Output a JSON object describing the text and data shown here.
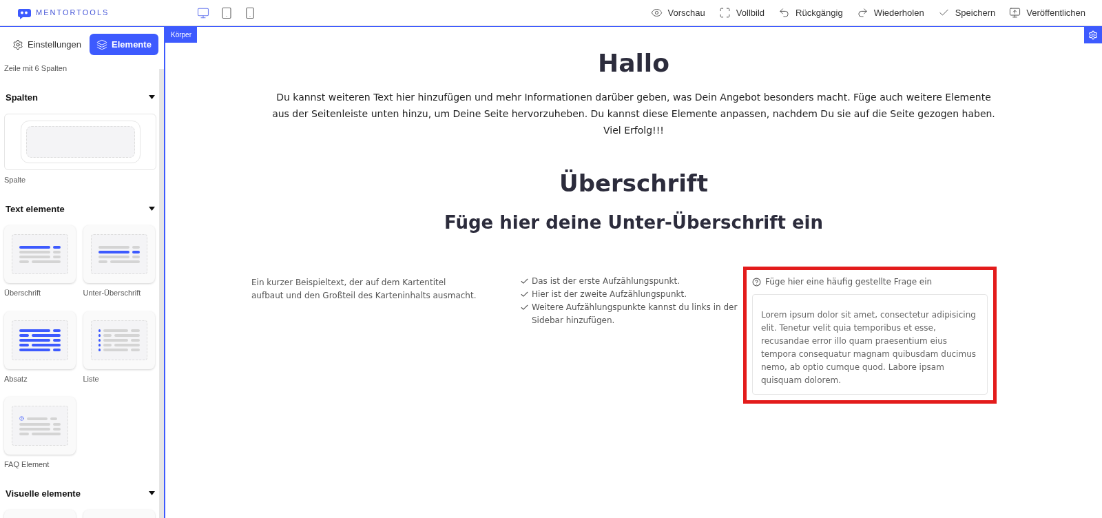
{
  "header": {
    "logo": "MENTORTOOLS",
    "devices": [
      {
        "kind": "desktop",
        "selected": true
      },
      {
        "kind": "tablet",
        "selected": false
      },
      {
        "kind": "phone",
        "selected": false
      }
    ],
    "actions": [
      {
        "kind": "preview",
        "label": "Vorschau"
      },
      {
        "kind": "fullscreen",
        "label": "Vollbild"
      },
      {
        "kind": "undo",
        "label": "Rückgängig"
      },
      {
        "kind": "redo",
        "label": "Wiederholen"
      },
      {
        "kind": "save",
        "label": "Speichern"
      },
      {
        "kind": "publish",
        "label": "Veröffentlichen"
      }
    ]
  },
  "sidebar": {
    "tabs": [
      {
        "kind": "settings",
        "label": "Einstellungen",
        "selected": false
      },
      {
        "kind": "elements",
        "label": "Elemente",
        "selected": true
      }
    ],
    "top_item": "Zeile mit 6 Spalten",
    "sections": [
      {
        "title": "Spalten",
        "expanded": true,
        "items": [
          {
            "kind": "column",
            "label": "Spalte"
          }
        ]
      },
      {
        "title": "Text elemente",
        "expanded": true,
        "items": [
          {
            "kind": "heading",
            "label": "Überschrift"
          },
          {
            "kind": "subheading",
            "label": "Unter-Überschrift"
          },
          {
            "kind": "paragraph",
            "label": "Absatz"
          },
          {
            "kind": "list",
            "label": "Liste"
          },
          {
            "kind": "faq",
            "label": "FAQ Element"
          }
        ]
      },
      {
        "title": "Visuelle elemente",
        "expanded": true,
        "items": [
          {
            "kind": "blank"
          },
          {
            "kind": "blank"
          }
        ]
      }
    ]
  },
  "canvas": {
    "body_tag": "Körper",
    "title": "Hallo",
    "intro": "Du kannst weiteren Text hier hinzufügen und mehr Informationen darüber geben, was Dein Angebot besonders macht. Füge auch weitere Elemente aus der Seitenleiste unten hinzu, um Deine Seite hervorzuheben. Du kannst diese Elemente anpassen, nachdem Du sie auf die Seite gezogen haben. Viel Erfolg!!!",
    "heading": "Überschrift",
    "subheading": "Füge hier deine Unter-Überschrift ein",
    "card_text": "Ein kurzer Beispieltext, der auf dem Kartentitel aufbaut und den Großteil des Karteninhalts ausmacht.",
    "bullets": [
      "Das ist der erste Aufzählungspunkt.",
      "Hier ist der zweite Aufzählungspunkt.",
      "Weitere Aufzählungspunkte kannst du links in der Sidebar hinzufügen."
    ],
    "faq": {
      "question": "Füge hier eine häufig gestellte Frage ein",
      "answer": "Lorem ipsum dolor sit amet, consectetur adipisicing elit. Tenetur velit quia temporibus et esse, recusandae error illo quam praesentium eius tempora consequatur magnam quibusdam ducimus nemo, ab optio cumque quod. Labore ipsam quisquam dolorem.",
      "selected": true
    }
  }
}
